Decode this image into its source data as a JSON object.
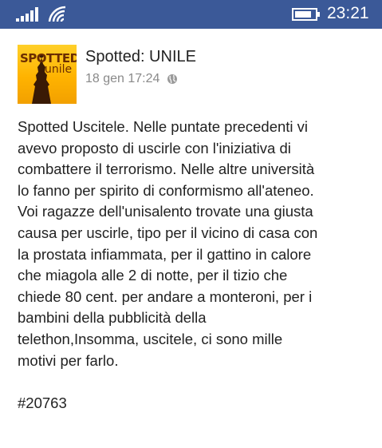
{
  "status_bar": {
    "time": "23:21",
    "icons": [
      "signal-icon",
      "wifi-icon",
      "battery-icon"
    ],
    "background": "#3b5998"
  },
  "post": {
    "page_name": "Spotted: UNILE",
    "date": "18 gen 17:24",
    "privacy_icon": "globe-icon",
    "avatar": {
      "line1": "SPOTTED",
      "line2": "unile"
    },
    "body_lines": [
      "Spotted Uscitele.  Nelle puntate precedenti vi",
      "avevo proposto di uscirle con l'iniziativa di",
      "combattere il terrorismo. Nelle altre università",
      "lo fanno per spirito di conformismo all'ateneo.",
      "Voi ragazze dell'unisalento trovate una giusta",
      "causa per uscirle, tipo per il vicino di casa con",
      "la prostata infiammata, per il gattino in calore",
      "che miagola alle 2 di notte, per il tizio che",
      "chiede 80 cent. per andare a monteroni, per i",
      "bambini della pubblicità della",
      "telethon,Insomma, uscitele, ci sono mille",
      "motivi per farlo."
    ],
    "hashtag": "#20763"
  }
}
